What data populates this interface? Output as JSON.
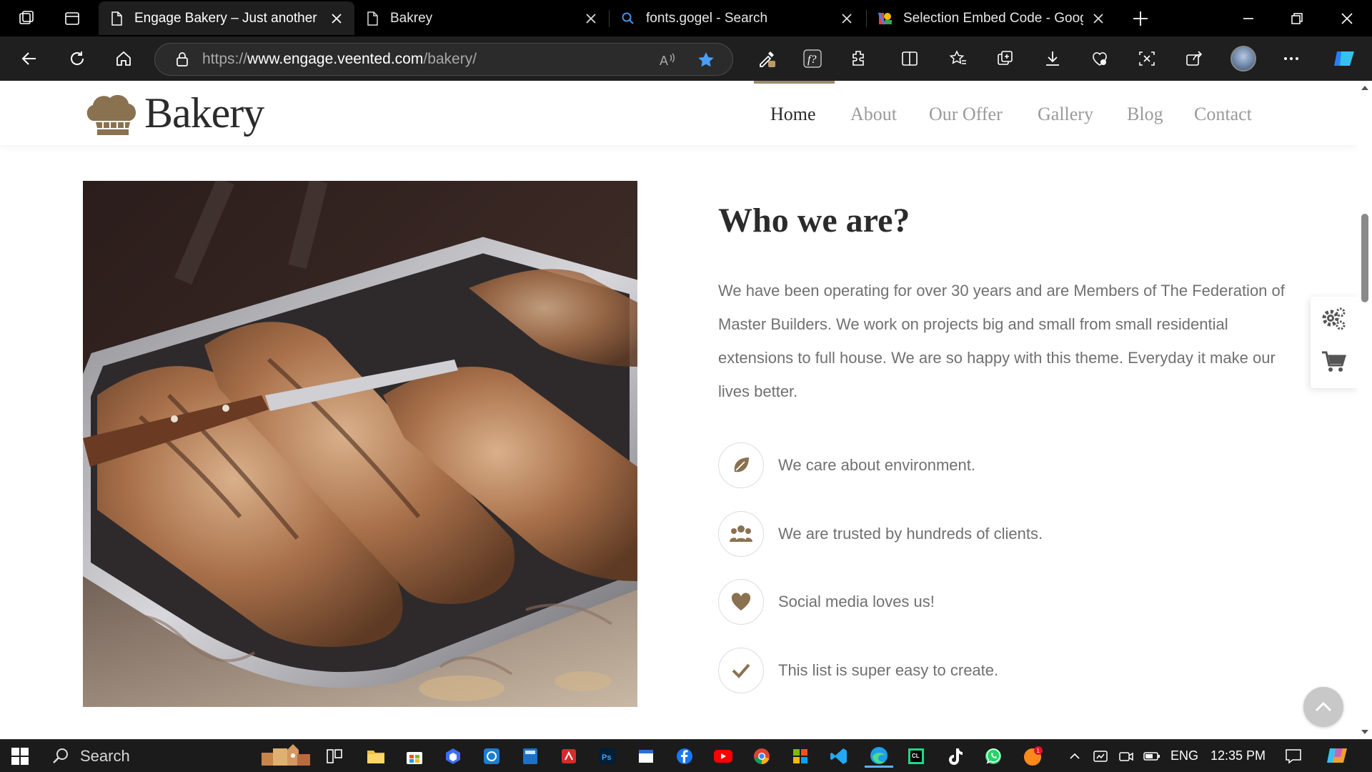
{
  "browser": {
    "tabs": [
      {
        "title": "Engage Bakery – Just another Eng",
        "active": true
      },
      {
        "title": "Bakrey",
        "active": false
      },
      {
        "title": "fonts.gogel - Search",
        "active": false
      },
      {
        "title": "Selection Embed Code - Google F",
        "active": false
      }
    ],
    "address": {
      "url_prefix": "https://",
      "url_host": "www.engage.veented.com",
      "url_path": "/bakery/"
    }
  },
  "site": {
    "logo_text": "Bakery",
    "nav": [
      {
        "label": "Home",
        "active": true
      },
      {
        "label": "About",
        "active": false
      },
      {
        "label": "Our Offer",
        "active": false
      },
      {
        "label": "Gallery",
        "active": false
      },
      {
        "label": "Blog",
        "active": false
      },
      {
        "label": "Contact",
        "active": false
      }
    ]
  },
  "content": {
    "title": "Who we are?",
    "text": "We have been operating for over 30 years and are Members of The Federation of Master Builders. We work on projects big and small from small residential extensions to full house. We are so happy with this theme. Everyday it make our lives better.",
    "features": [
      {
        "icon": "leaf-icon",
        "text": "We care about environment."
      },
      {
        "icon": "users-icon",
        "text": "We are trusted by hundreds of clients."
      },
      {
        "icon": "heart-icon",
        "text": "Social media loves us!"
      },
      {
        "icon": "check-icon",
        "text": "This list is super easy to create."
      }
    ]
  },
  "colors": {
    "accent": "#8a7150",
    "heading": "#2b2b2b",
    "body_text": "#707070"
  },
  "taskbar": {
    "search_label": "Search",
    "language": "ENG",
    "time": "12:35 PM",
    "notification_badge": "1"
  }
}
